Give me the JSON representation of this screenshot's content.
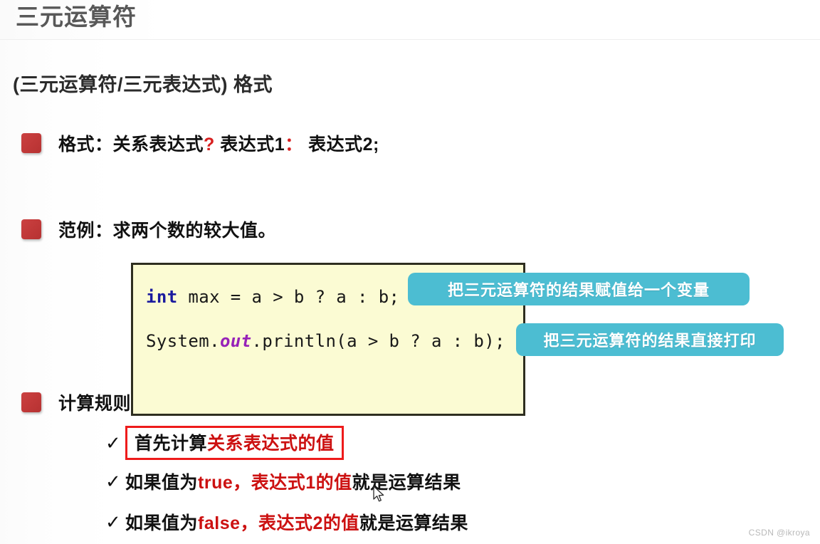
{
  "header": {
    "title": "三元运算符"
  },
  "subtitle": "(三元运算符/三元表达式) 格式",
  "bullets": [
    {
      "id": "format",
      "prefix": "格式：关系表达式",
      "op_question": "?",
      "mid": " 表达式1",
      "op_colon": "：",
      "suffix": " 表达式2;"
    },
    {
      "id": "example",
      "text": "范例：求两个数的较大值。"
    },
    {
      "id": "rules",
      "text": "计算规则"
    }
  ],
  "code": {
    "line1": {
      "keyword": "int",
      "rest": " max = a > b ? a : b;"
    },
    "line2": {
      "pre": "System.",
      "field": "out",
      "post": ".println(a > b ? a : b);"
    }
  },
  "callouts": [
    {
      "id": "assign",
      "text": "把三元运算符的结果赋值给一个变量"
    },
    {
      "id": "print",
      "text": "把三元运算符的结果直接打印"
    }
  ],
  "rules": [
    {
      "check": "✓",
      "boxed": true,
      "black_1": "首先计算",
      "red_1": "关系表达式的值",
      "black_2": ""
    },
    {
      "check": "✓",
      "boxed": false,
      "black_1": "如果值为",
      "red_1": "true，表达式1的值",
      "black_2": "就是运算结果"
    },
    {
      "check": "✓",
      "boxed": false,
      "black_1": "如果值为",
      "red_1": "false，表达式2的值",
      "black_2": "就是运算结果"
    }
  ],
  "watermark": "CSDN @ikroya",
  "colors": {
    "title": "#585858",
    "bullet_square": "#c03838",
    "accent_red": "#d81f1f",
    "code_bg": "#fbfbd3",
    "code_border": "#2e2e20",
    "keyword_blue": "#1a1a9e",
    "field_purple": "#9722b8",
    "callout_teal": "#4cbdd2",
    "highlight_box": "#ee1b1b"
  }
}
